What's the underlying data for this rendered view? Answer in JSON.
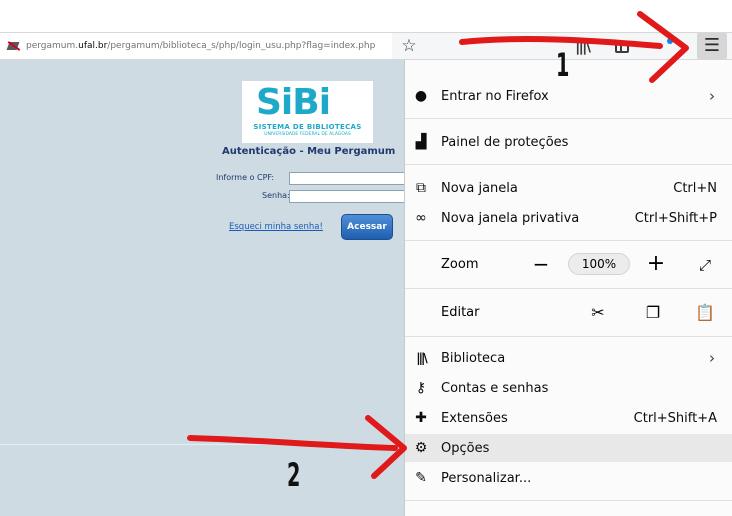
{
  "browser": {
    "url_prefix": "pergamum.",
    "url_domain": "ufal.br",
    "url_path": "/pergamum/biblioteca_s/php/login_usu.php?flag=index.php",
    "menu_button_glyph": "☰"
  },
  "page": {
    "logo_word": "SiBi",
    "logo_sub": "SISTEMA DE BIBLIOTECAS",
    "logo_sub2": "UNIVERSIDADE FEDERAL DE ALAGOAS",
    "auth_title": "Autenticação - Meu Pergamum",
    "cpf_label": "Informe o CPF:",
    "senha_label": "Senha:",
    "cpf_value": "",
    "senha_value": "",
    "forgot_link": "Esqueci minha senha!",
    "submit_button": "Acessar"
  },
  "menu": {
    "sign_in": "Entrar no Firefox",
    "protections": "Painel de proteções",
    "new_window": "Nova janela",
    "new_window_key": "Ctrl+N",
    "private_window": "Nova janela privativa",
    "private_window_key": "Ctrl+Shift+P",
    "zoom_label": "Zoom",
    "zoom_value": "100%",
    "edit_label": "Editar",
    "library": "Biblioteca",
    "logins": "Contas e senhas",
    "addons": "Extensões",
    "addons_key": "Ctrl+Shift+A",
    "options": "Opções",
    "customize": "Personalizar..."
  },
  "annotations": {
    "step1": "1",
    "step2": "2",
    "arrow_color": "#e0191a"
  },
  "colors": {
    "page_bg": "#cfdbe3",
    "logo_accent": "#1fa9c8",
    "title_text": "#1f3a6e",
    "button_blue": "#1f5fb0",
    "highlight": "#e8e8e9"
  }
}
